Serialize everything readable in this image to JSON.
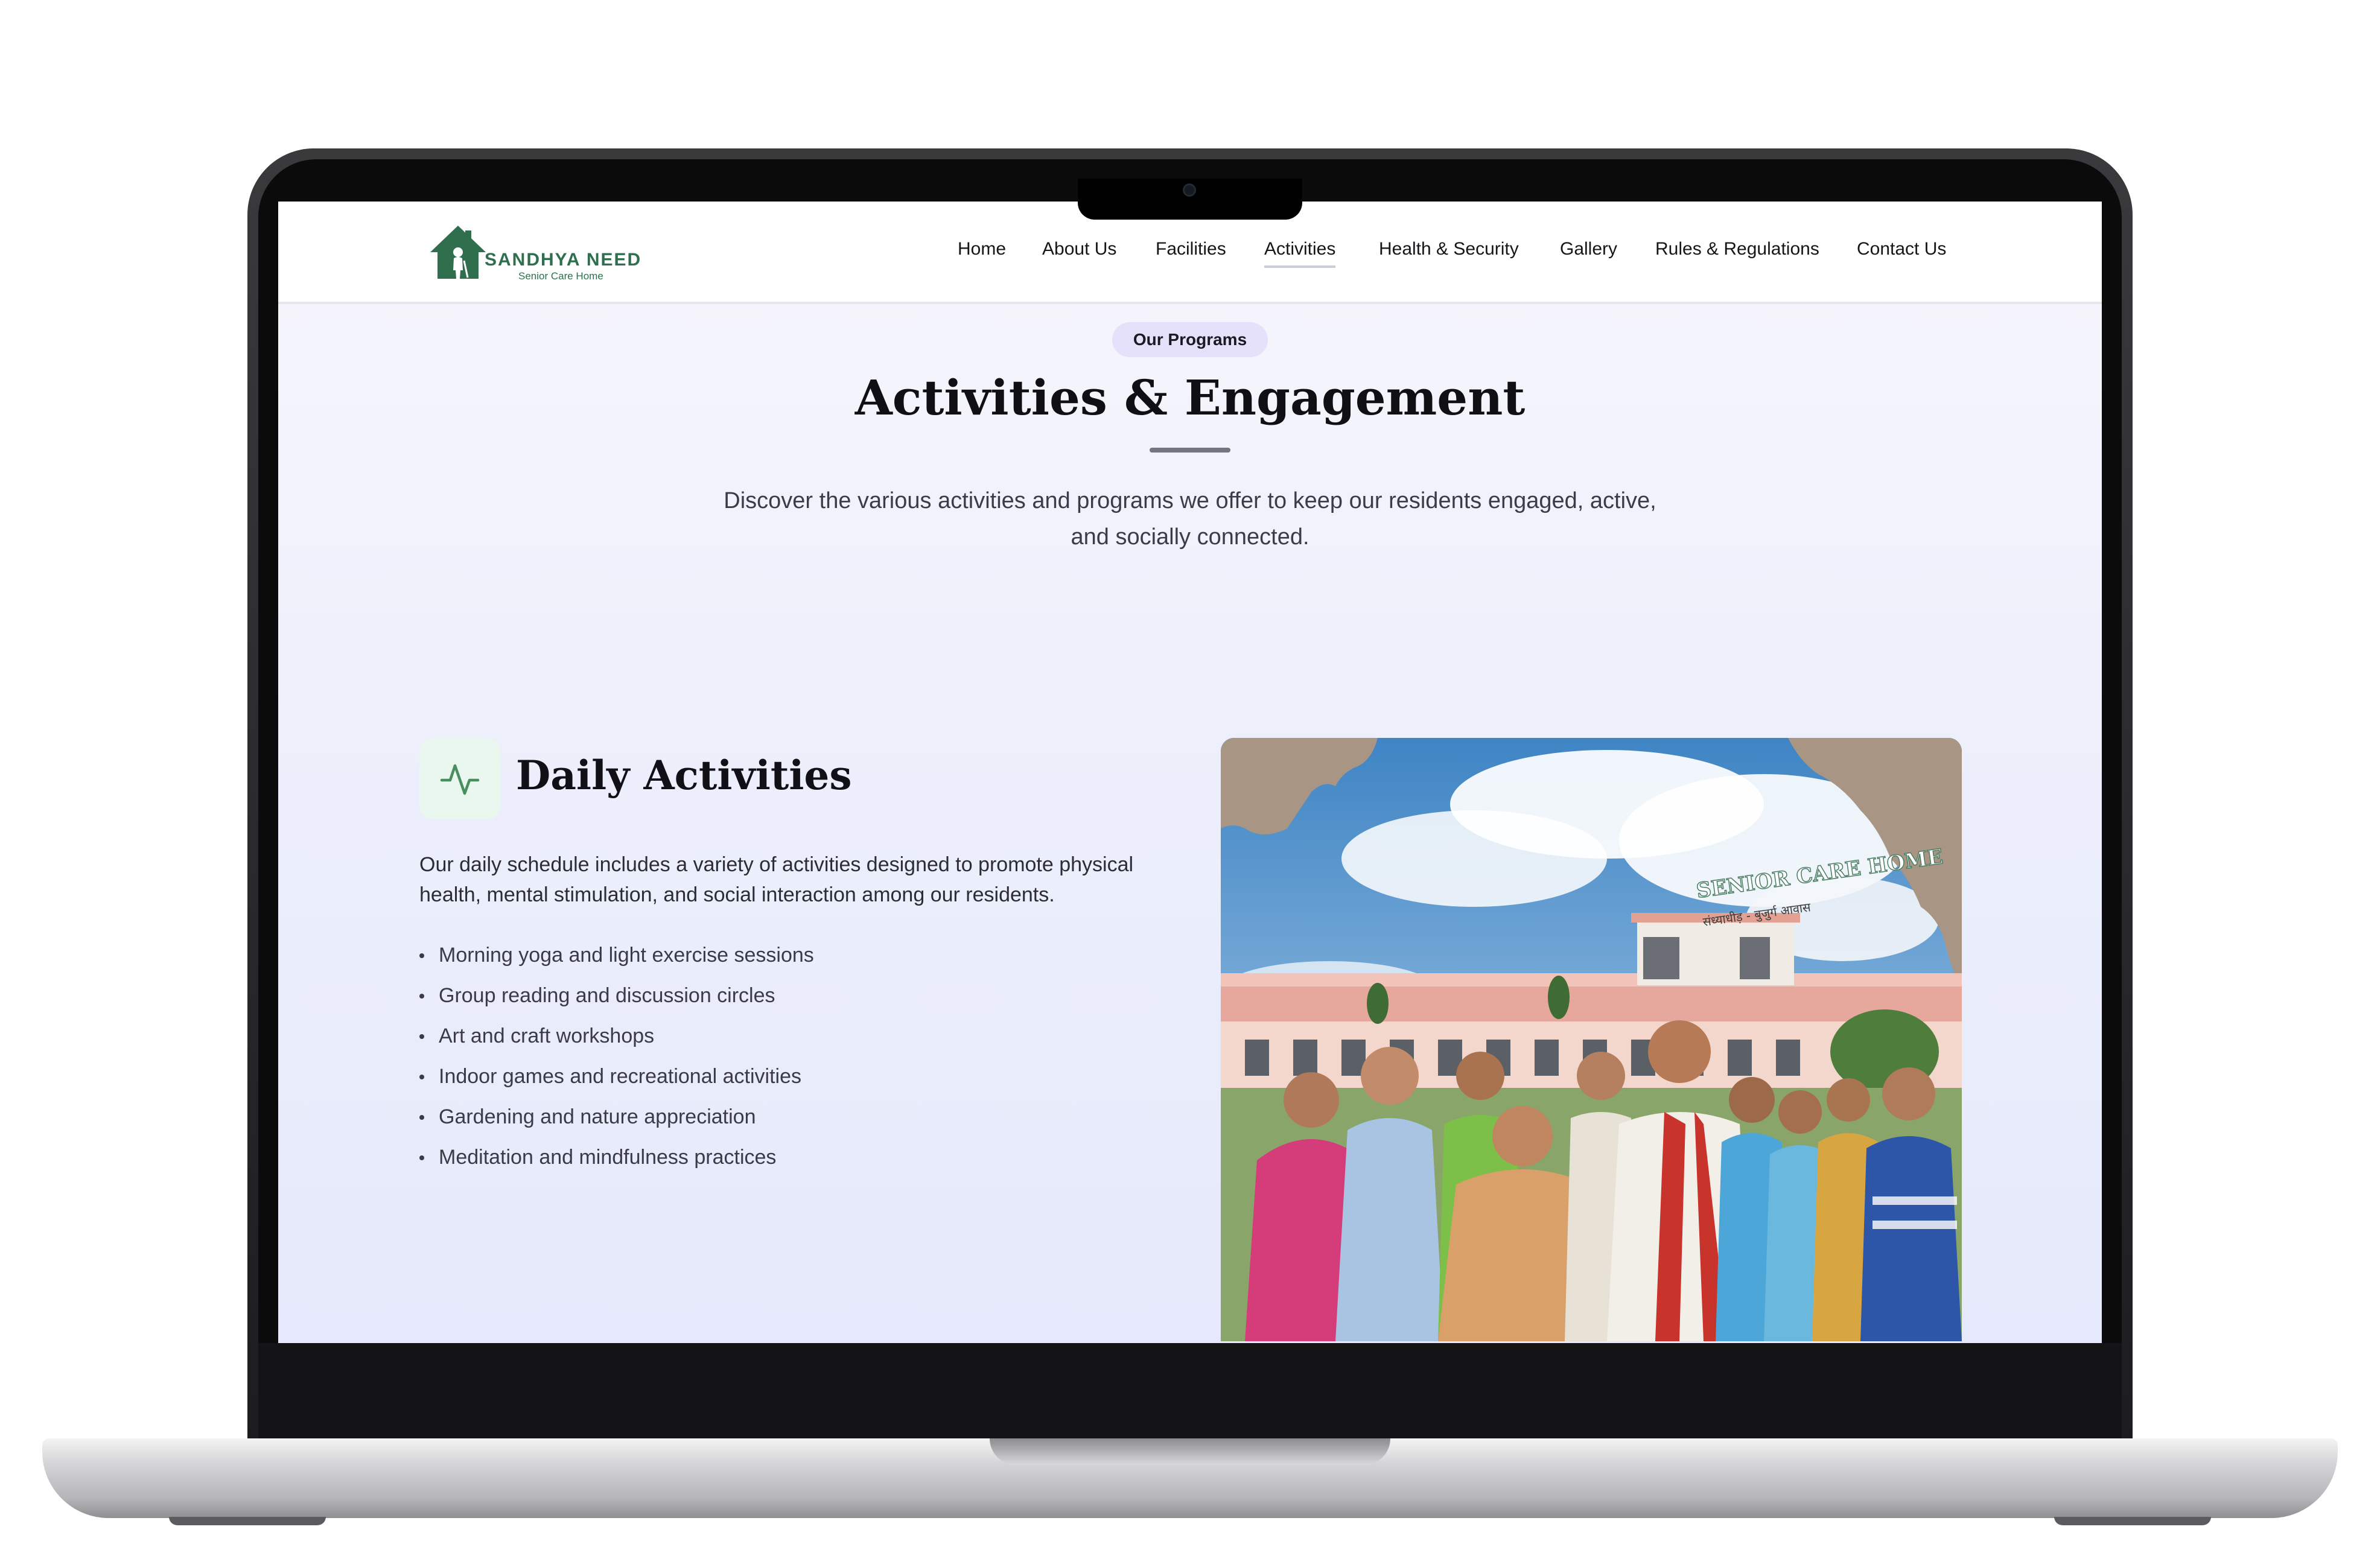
{
  "site": {
    "logo_name": "SANDHYA NEED",
    "logo_tagline": "Senior Care Home",
    "brand_color": "#2f6f4e"
  },
  "nav": {
    "items": [
      {
        "label": "Home"
      },
      {
        "label": "About Us"
      },
      {
        "label": "Facilities"
      },
      {
        "label": "Activities",
        "active": true
      },
      {
        "label": "Health & Security"
      },
      {
        "label": "Gallery"
      },
      {
        "label": "Rules & Regulations"
      },
      {
        "label": "Contact Us"
      }
    ]
  },
  "hero": {
    "badge": "Our Programs",
    "title": "Activities & Engagement",
    "intro_line1": "Discover the various activities and programs we offer to keep our residents engaged, active,",
    "intro_line2": "and socially connected."
  },
  "daily_activities": {
    "icon": "activity-pulse-icon",
    "title": "Daily Activities",
    "description_line1": "Our daily schedule includes a variety of activities designed to promote physical",
    "description_line2": "health, mental stimulation, and social interaction among our residents.",
    "items": [
      "Morning yoga and light exercise sessions",
      "Group reading and discussion circles",
      "Art and craft workshops",
      "Indoor games and recreational activities",
      "Gardening and nature appreciation",
      "Meditation and mindfulness practices"
    ]
  },
  "photo": {
    "building_sign": "SENIOR CARE HOME",
    "building_sign_hindi": "संध्याधीड़ - बुजुर्ग आवास"
  }
}
